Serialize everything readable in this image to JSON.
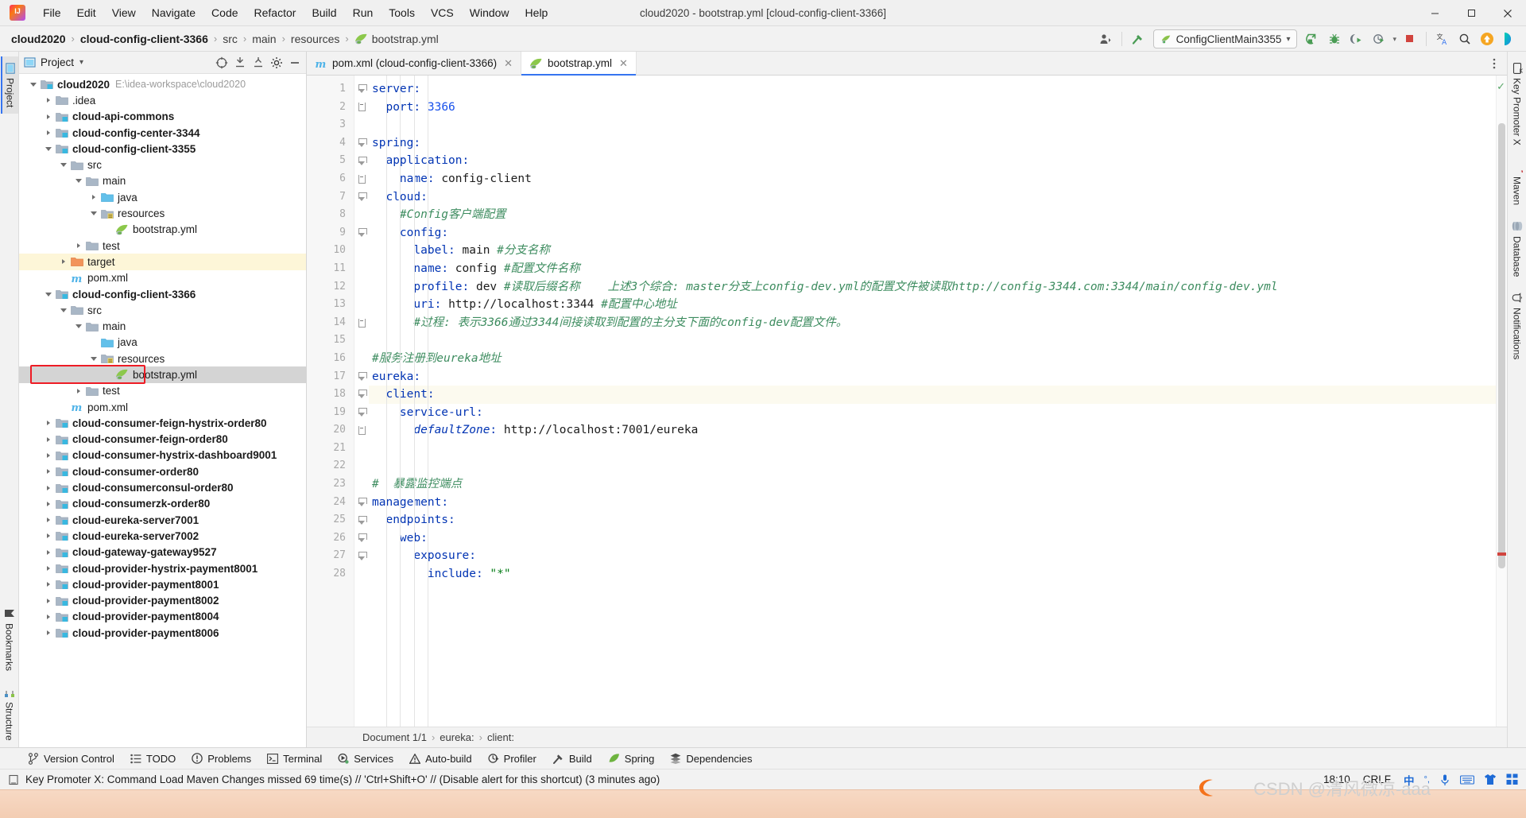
{
  "window": {
    "title": "cloud2020 - bootstrap.yml [cloud-config-client-3366]",
    "minimize": "–",
    "maximize": "❐",
    "close": "✕"
  },
  "menu": {
    "items": [
      "File",
      "Edit",
      "View",
      "Navigate",
      "Code",
      "Refactor",
      "Build",
      "Run",
      "Tools",
      "VCS",
      "Window",
      "Help"
    ]
  },
  "breadcrumb": {
    "items": [
      {
        "label": "cloud2020",
        "bold": true,
        "icon": ""
      },
      {
        "label": "cloud-config-client-3366",
        "bold": true,
        "icon": ""
      },
      {
        "label": "src",
        "bold": false,
        "icon": ""
      },
      {
        "label": "main",
        "bold": false,
        "icon": ""
      },
      {
        "label": "resources",
        "bold": false,
        "icon": ""
      },
      {
        "label": "bootstrap.yml",
        "bold": false,
        "icon": "yml-icon"
      }
    ],
    "separator": "›"
  },
  "toolbar": {
    "run_config_label": "ConfigClientMain3355",
    "run_config_caret": "▾",
    "profile_caret": "▾",
    "buttons": [
      {
        "name": "user-account-icon",
        "label": ""
      },
      {
        "name": "build-hammer-icon",
        "label": ""
      },
      {
        "name": "run-icon",
        "label": ""
      },
      {
        "name": "debug-icon",
        "label": ""
      },
      {
        "name": "run-with-coverage-icon",
        "label": ""
      },
      {
        "name": "profiler-icon",
        "label": ""
      },
      {
        "name": "stop-icon",
        "label": ""
      },
      {
        "name": "translate-icon",
        "label": ""
      },
      {
        "name": "search-everywhere-icon",
        "label": ""
      },
      {
        "name": "update-icon",
        "label": ""
      },
      {
        "name": "ide-feature-icon",
        "label": ""
      }
    ]
  },
  "project_panel": {
    "title": "Project",
    "title_caret": "▾",
    "actions": [
      {
        "name": "select-opened-file-icon"
      },
      {
        "name": "expand-all-icon"
      },
      {
        "name": "collapse-all-icon"
      },
      {
        "name": "settings-gear-icon"
      },
      {
        "name": "hide-panel-icon"
      }
    ],
    "tree": [
      {
        "depth": 0,
        "twisty": "open",
        "icon": "module-folder",
        "label": "cloud2020",
        "bold": true,
        "path": "E:\\idea-workspace\\cloud2020"
      },
      {
        "depth": 1,
        "twisty": "closed",
        "icon": "folder",
        "label": ".idea",
        "bold": false
      },
      {
        "depth": 1,
        "twisty": "closed",
        "icon": "module-folder",
        "label": "cloud-api-commons",
        "bold": true
      },
      {
        "depth": 1,
        "twisty": "closed",
        "icon": "module-folder",
        "label": "cloud-config-center-3344",
        "bold": true
      },
      {
        "depth": 1,
        "twisty": "open",
        "icon": "module-folder",
        "label": "cloud-config-client-3355",
        "bold": true
      },
      {
        "depth": 2,
        "twisty": "open",
        "icon": "folder",
        "label": "src",
        "bold": false
      },
      {
        "depth": 3,
        "twisty": "open",
        "icon": "folder",
        "label": "main",
        "bold": false
      },
      {
        "depth": 4,
        "twisty": "closed",
        "icon": "source-folder",
        "label": "java",
        "bold": false
      },
      {
        "depth": 4,
        "twisty": "open",
        "icon": "resource-folder",
        "label": "resources",
        "bold": false
      },
      {
        "depth": 5,
        "twisty": "none",
        "icon": "yml-file",
        "label": "bootstrap.yml",
        "bold": false
      },
      {
        "depth": 3,
        "twisty": "closed",
        "icon": "folder",
        "label": "test",
        "bold": false
      },
      {
        "depth": 2,
        "twisty": "closed",
        "icon": "target-folder",
        "label": "target",
        "bold": false,
        "highlight": true
      },
      {
        "depth": 2,
        "twisty": "none",
        "icon": "maven-file",
        "label": "pom.xml",
        "bold": false
      },
      {
        "depth": 1,
        "twisty": "open",
        "icon": "module-folder",
        "label": "cloud-config-client-3366",
        "bold": true
      },
      {
        "depth": 2,
        "twisty": "open",
        "icon": "folder",
        "label": "src",
        "bold": false
      },
      {
        "depth": 3,
        "twisty": "open",
        "icon": "folder",
        "label": "main",
        "bold": false
      },
      {
        "depth": 4,
        "twisty": "none",
        "icon": "source-folder",
        "label": "java",
        "bold": false
      },
      {
        "depth": 4,
        "twisty": "open",
        "icon": "resource-folder",
        "label": "resources",
        "bold": false
      },
      {
        "depth": 5,
        "twisty": "none",
        "icon": "yml-file",
        "label": "bootstrap.yml",
        "bold": false,
        "selected": true,
        "boxed": true
      },
      {
        "depth": 3,
        "twisty": "closed",
        "icon": "folder",
        "label": "test",
        "bold": false
      },
      {
        "depth": 2,
        "twisty": "none",
        "icon": "maven-file",
        "label": "pom.xml",
        "bold": false
      },
      {
        "depth": 1,
        "twisty": "closed",
        "icon": "module-folder",
        "label": "cloud-consumer-feign-hystrix-order80",
        "bold": true
      },
      {
        "depth": 1,
        "twisty": "closed",
        "icon": "module-folder",
        "label": "cloud-consumer-feign-order80",
        "bold": true
      },
      {
        "depth": 1,
        "twisty": "closed",
        "icon": "module-folder",
        "label": "cloud-consumer-hystrix-dashboard9001",
        "bold": true
      },
      {
        "depth": 1,
        "twisty": "closed",
        "icon": "module-folder",
        "label": "cloud-consumer-order80",
        "bold": true
      },
      {
        "depth": 1,
        "twisty": "closed",
        "icon": "module-folder",
        "label": "cloud-consumerconsul-order80",
        "bold": true
      },
      {
        "depth": 1,
        "twisty": "closed",
        "icon": "module-folder",
        "label": "cloud-consumerzk-order80",
        "bold": true
      },
      {
        "depth": 1,
        "twisty": "closed",
        "icon": "module-folder",
        "label": "cloud-eureka-server7001",
        "bold": true
      },
      {
        "depth": 1,
        "twisty": "closed",
        "icon": "module-folder",
        "label": "cloud-eureka-server7002",
        "bold": true
      },
      {
        "depth": 1,
        "twisty": "closed",
        "icon": "module-folder",
        "label": "cloud-gateway-gateway9527",
        "bold": true
      },
      {
        "depth": 1,
        "twisty": "closed",
        "icon": "module-folder",
        "label": "cloud-provider-hystrix-payment8001",
        "bold": true
      },
      {
        "depth": 1,
        "twisty": "closed",
        "icon": "module-folder",
        "label": "cloud-provider-payment8001",
        "bold": true
      },
      {
        "depth": 1,
        "twisty": "closed",
        "icon": "module-folder",
        "label": "cloud-provider-payment8002",
        "bold": true
      },
      {
        "depth": 1,
        "twisty": "closed",
        "icon": "module-folder",
        "label": "cloud-provider-payment8004",
        "bold": true
      },
      {
        "depth": 1,
        "twisty": "closed",
        "icon": "module-folder",
        "label": "cloud-provider-payment8006",
        "bold": true
      }
    ]
  },
  "editor": {
    "tabs": [
      {
        "label": "pom.xml (cloud-config-client-3366)",
        "icon": "maven-file",
        "active": false,
        "close": "✕"
      },
      {
        "label": "bootstrap.yml",
        "icon": "yml-file",
        "active": true,
        "close": "✕"
      }
    ],
    "inspection_ok": "✓",
    "current_line": 18,
    "lines": [
      {
        "n": 1,
        "fold": "arrow",
        "indent": 0,
        "text": "server:"
      },
      {
        "n": 2,
        "fold": "end",
        "indent": 1,
        "text": "  port: 3366"
      },
      {
        "n": 3,
        "fold": "",
        "indent": 0,
        "text": ""
      },
      {
        "n": 4,
        "fold": "arrow",
        "indent": 0,
        "text": "spring:"
      },
      {
        "n": 5,
        "fold": "arrow",
        "indent": 1,
        "text": "  application:"
      },
      {
        "n": 6,
        "fold": "end",
        "indent": 2,
        "text": "    name: config-client"
      },
      {
        "n": 7,
        "fold": "arrow",
        "indent": 1,
        "text": "  cloud:"
      },
      {
        "n": 8,
        "fold": "",
        "indent": 2,
        "text": "    #Config客户端配置"
      },
      {
        "n": 9,
        "fold": "arrow",
        "indent": 2,
        "text": "    config:"
      },
      {
        "n": 10,
        "fold": "",
        "indent": 3,
        "text": "      label: main #分支名称"
      },
      {
        "n": 11,
        "fold": "",
        "indent": 3,
        "text": "      name: config #配置文件名称"
      },
      {
        "n": 12,
        "fold": "",
        "indent": 3,
        "text": "      profile: dev #读取后缀名称    上述3个综合: master分支上config-dev.yml的配置文件被读取http://config-3344.com:3344/main/config-dev.yml"
      },
      {
        "n": 13,
        "fold": "",
        "indent": 3,
        "text": "      uri: http://localhost:3344 #配置中心地址"
      },
      {
        "n": 14,
        "fold": "end",
        "indent": 3,
        "text": "      #过程: 表示3366通过3344间接读取到配置的主分支下面的config-dev配置文件。"
      },
      {
        "n": 15,
        "fold": "",
        "indent": 0,
        "text": ""
      },
      {
        "n": 16,
        "fold": "",
        "indent": 0,
        "text": "#服务注册到eureka地址"
      },
      {
        "n": 17,
        "fold": "arrow",
        "indent": 0,
        "text": "eureka:"
      },
      {
        "n": 18,
        "fold": "arrow",
        "indent": 1,
        "text": "  client:"
      },
      {
        "n": 19,
        "fold": "arrow",
        "indent": 2,
        "text": "    service-url:"
      },
      {
        "n": 20,
        "fold": "end",
        "indent": 3,
        "text": "      defaultZone: http://localhost:7001/eureka"
      },
      {
        "n": 21,
        "fold": "",
        "indent": 0,
        "text": ""
      },
      {
        "n": 22,
        "fold": "",
        "indent": 0,
        "text": ""
      },
      {
        "n": 23,
        "fold": "",
        "indent": 0,
        "text": "#  暴露监控端点"
      },
      {
        "n": 24,
        "fold": "arrow",
        "indent": 0,
        "text": "management:"
      },
      {
        "n": 25,
        "fold": "arrow",
        "indent": 1,
        "text": "  endpoints:"
      },
      {
        "n": 26,
        "fold": "arrow",
        "indent": 2,
        "text": "    web:"
      },
      {
        "n": 27,
        "fold": "arrow",
        "indent": 3,
        "text": "      exposure:"
      },
      {
        "n": 28,
        "fold": "",
        "indent": 4,
        "text": "        include: \"*\""
      }
    ]
  },
  "document_bar": {
    "document": "Document 1/1",
    "crumbs": [
      "eureka:",
      "client:"
    ],
    "separator": "›"
  },
  "left_rail": {
    "tabs": [
      {
        "label": "Project",
        "icon": "project-icon",
        "active": true
      },
      {
        "label": "Bookmarks",
        "icon": "bookmark-icon",
        "active": false
      },
      {
        "label": "Structure",
        "icon": "structure-icon",
        "active": false
      }
    ]
  },
  "right_rail": {
    "tabs": [
      {
        "label": "Key Promoter X",
        "icon": "key-promoter-icon"
      },
      {
        "label": "Maven",
        "icon": "maven-icon"
      },
      {
        "label": "Database",
        "icon": "database-icon"
      },
      {
        "label": "Notifications",
        "icon": "notifications-icon"
      }
    ]
  },
  "bottom_toolbar": {
    "items": [
      {
        "label": "Version Control",
        "icon": "branch-icon"
      },
      {
        "label": "TODO",
        "icon": "todo-icon"
      },
      {
        "label": "Problems",
        "icon": "problems-icon"
      },
      {
        "label": "Terminal",
        "icon": "terminal-icon"
      },
      {
        "label": "Services",
        "icon": "services-icon"
      },
      {
        "label": "Auto-build",
        "icon": "autobuild-icon"
      },
      {
        "label": "Profiler",
        "icon": "profiler-icon"
      },
      {
        "label": "Build",
        "icon": "build-hammer-icon"
      },
      {
        "label": "Spring",
        "icon": "spring-leaf-icon"
      },
      {
        "label": "Dependencies",
        "icon": "dependencies-icon"
      }
    ]
  },
  "status_bar": {
    "message": "Key Promoter X: Command Load Maven Changes missed 69 time(s) // 'Ctrl+Shift+O' // (Disable alert for this shortcut) (3 minutes ago)",
    "time": "18:10",
    "line_separator": "CRLF",
    "watermark": "CSDN @清风微凉-aaa",
    "tray": [
      "中",
      "°•",
      "mic",
      "keyboard",
      "shirt",
      "apps"
    ]
  },
  "colors": {
    "accent": "#3574f0",
    "keyword": "#0033b3",
    "comment": "#3d8c5f",
    "number": "#1750eb",
    "string": "#067d17",
    "selection": "#d4d4d4",
    "highlight": "#fdf6d8",
    "red_box": "#ee1c25"
  }
}
